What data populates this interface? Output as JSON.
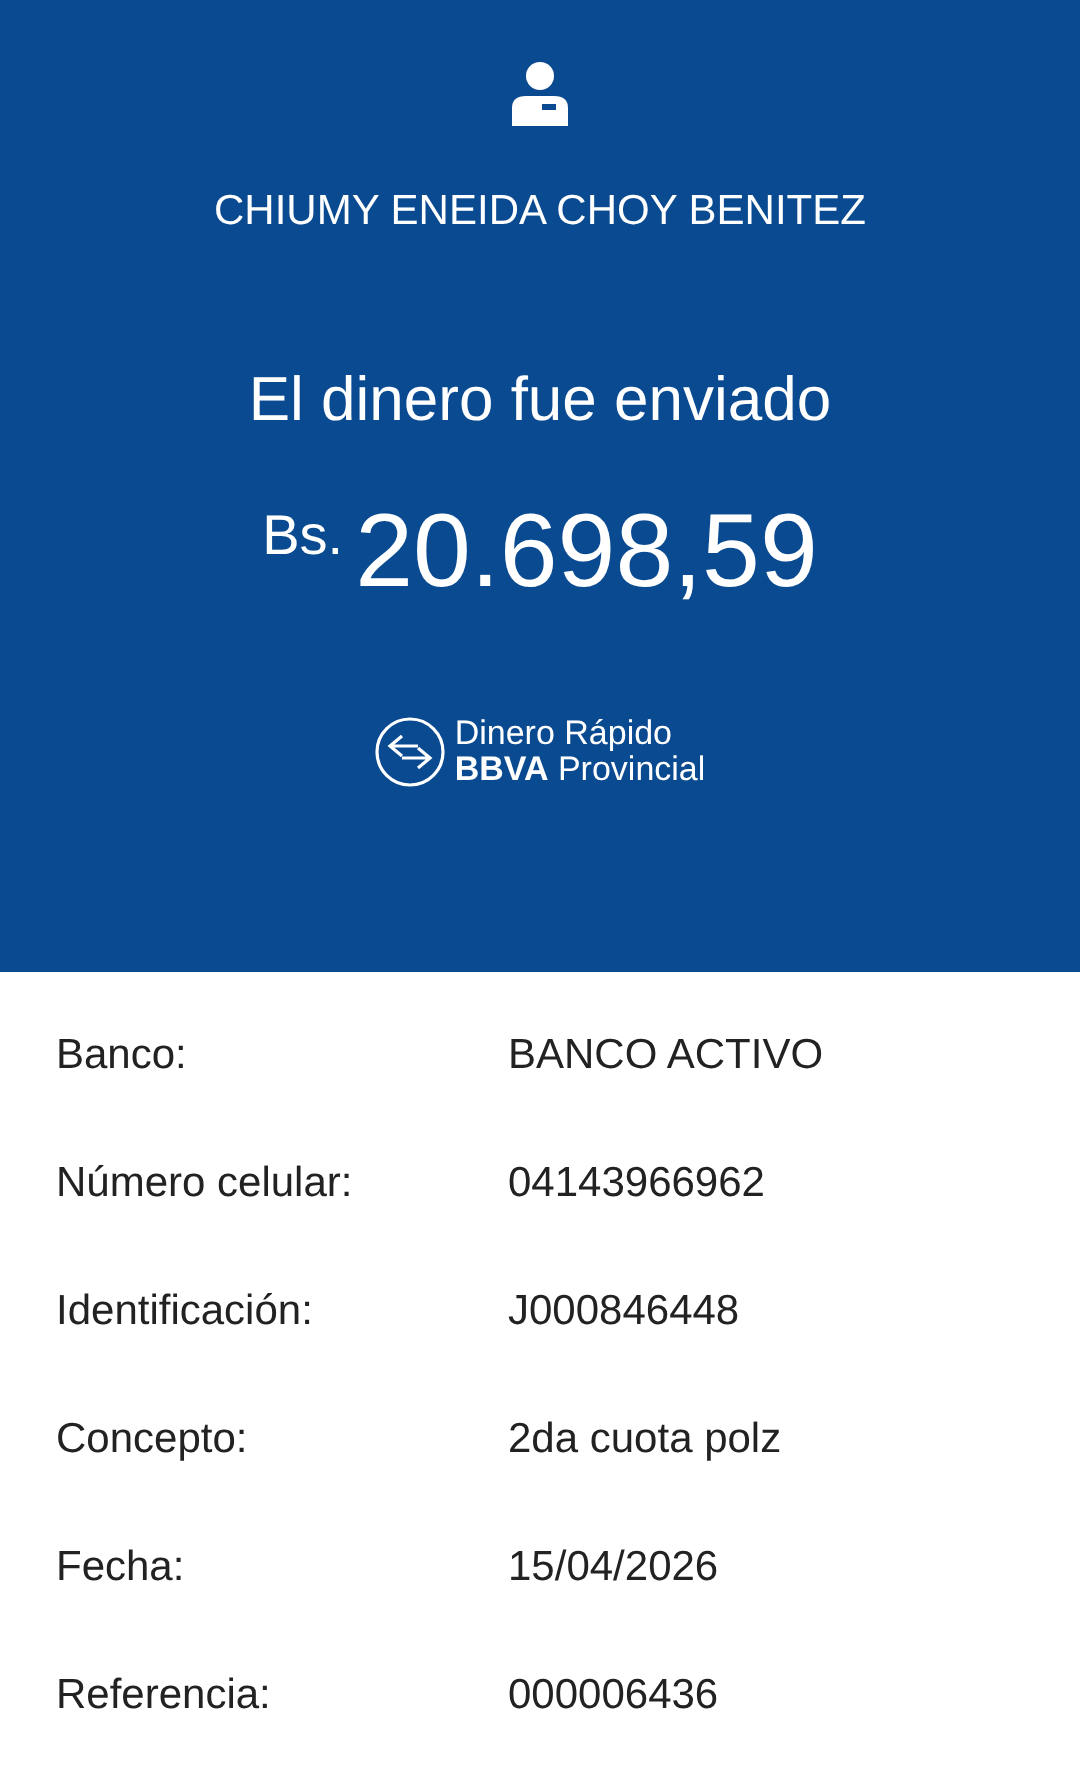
{
  "header": {
    "recipient": "CHIUMY ENEIDA CHOY BENITEZ",
    "message": "El dinero fue enviado",
    "currency": "Bs.",
    "amount": "20.698,59",
    "brand_line_1": "Dinero Rápido",
    "brand_line_2_bold": "BBVA",
    "brand_line_2": "Provincial"
  },
  "details": [
    {
      "label": "Banco:",
      "value": "BANCO ACTIVO"
    },
    {
      "label": "Número celular:",
      "value": "04143966962"
    },
    {
      "label": "Identificación:",
      "value": "J000846448"
    },
    {
      "label": "Concepto:",
      "value": "2da cuota polz"
    },
    {
      "label": "Fecha:",
      "value": "15/04/2026"
    },
    {
      "label": "Referencia:",
      "value": "000006436"
    }
  ]
}
